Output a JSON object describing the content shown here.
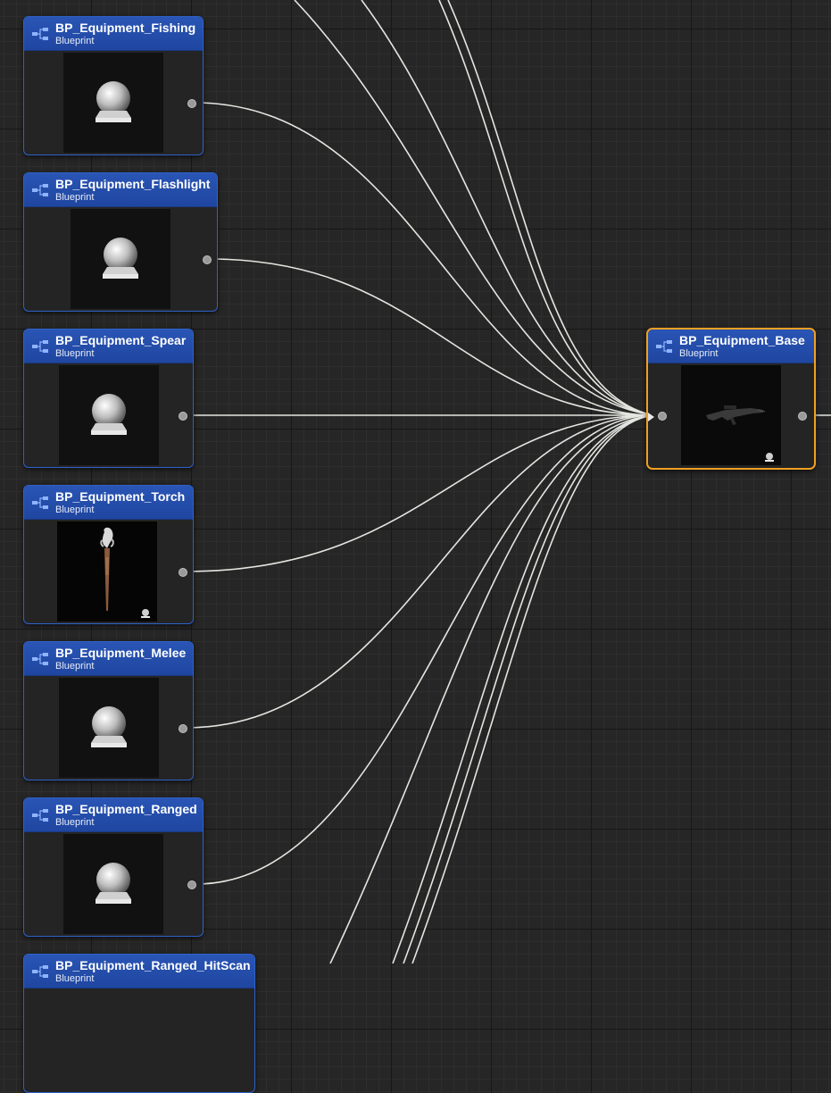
{
  "nodes": [
    {
      "id": "fishing",
      "title": "BP_Equipment_Fishing",
      "subtitle": "Blueprint",
      "thumb": "sphere-icon"
    },
    {
      "id": "flashlight",
      "title": "BP_Equipment_Flashlight",
      "subtitle": "Blueprint",
      "thumb": "sphere-icon"
    },
    {
      "id": "spear",
      "title": "BP_Equipment_Spear",
      "subtitle": "Blueprint",
      "thumb": "sphere-icon"
    },
    {
      "id": "torch",
      "title": "BP_Equipment_Torch",
      "subtitle": "Blueprint",
      "thumb": "torch-icon"
    },
    {
      "id": "melee",
      "title": "BP_Equipment_Melee",
      "subtitle": "Blueprint",
      "thumb": "sphere-icon"
    },
    {
      "id": "ranged",
      "title": "BP_Equipment_Ranged",
      "subtitle": "Blueprint",
      "thumb": "sphere-icon"
    },
    {
      "id": "ranged_hitscan",
      "title": "BP_Equipment_Ranged_HitScan",
      "subtitle": "Blueprint",
      "thumb": "sphere-icon"
    }
  ],
  "target": {
    "id": "base",
    "title": "BP_Equipment_Base",
    "subtitle": "Blueprint",
    "thumb": "rifle-icon",
    "selected": true
  },
  "colors": {
    "header": "#2a55b5",
    "border": "#2d62c9",
    "selected_border": "#f0a020",
    "wire": "#e8e8e8",
    "background": "#262626"
  }
}
